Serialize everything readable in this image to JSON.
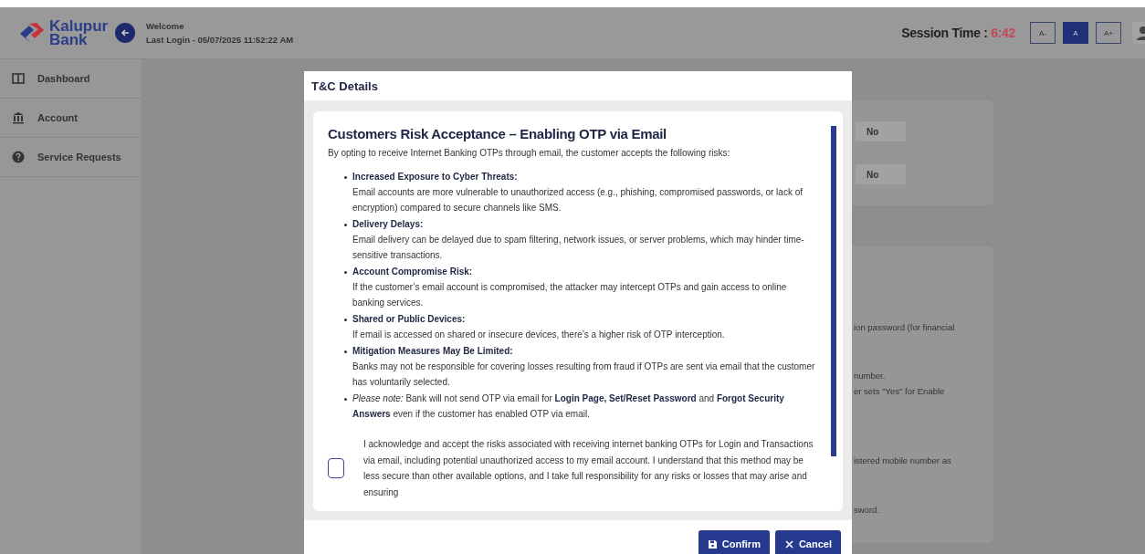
{
  "header": {
    "logo": {
      "line1": "Kalupur",
      "line2": "Bank"
    },
    "welcome": "Welcome",
    "last_login": "Last Login - 05/07/2025 11:52:22 AM",
    "session_label": "Session Time :",
    "session_time": "6:42",
    "font_buttons": [
      {
        "label": "A-",
        "selected": false
      },
      {
        "label": "A",
        "selected": true
      },
      {
        "label": "A+",
        "selected": false
      }
    ]
  },
  "sidebar": {
    "items": [
      {
        "kind": "dashboard",
        "label": "Dashboard"
      },
      {
        "kind": "account",
        "label": "Account"
      },
      {
        "kind": "help",
        "label": "Service Requests"
      }
    ]
  },
  "background": {
    "settings_values": [
      "No",
      "No"
    ],
    "info_lines": [
      "ion password (for financial",
      "number.",
      "er sets \"Yes\" for Enable",
      "istered mobile number as",
      "sword."
    ]
  },
  "modal": {
    "title": "T&C Details",
    "heading": "Customers Risk Acceptance – Enabling OTP via Email",
    "intro": "By opting to receive Internet Banking OTPs through email, the customer accepts the following risks:",
    "items": [
      {
        "kind": "risk",
        "title": "Increased Exposure to Cyber Threats:",
        "body": "Email accounts are more vulnerable to unauthorized access (e.g., phishing, compromised passwords, or lack of encryption) compared to secure channels like SMS."
      },
      {
        "kind": "risk",
        "title": "Delivery Delays:",
        "body": "Email delivery can be delayed due to spam filtering, network issues, or server problems, which may hinder time-sensitive transactions."
      },
      {
        "kind": "risk",
        "title": "Account Compromise Risk:",
        "body": "If the customer’s email account is compromised, the attacker may intercept OTPs and gain access to online banking services."
      },
      {
        "kind": "risk",
        "title": "Shared or Public Devices:",
        "body": "If email is accessed on shared or insecure devices, there’s a higher risk of OTP interception."
      },
      {
        "kind": "risk",
        "title": "Mitigation Measures May Be Limited:",
        "body": "Banks may not be responsible for covering losses resulting from fraud if OTPs are sent via email that the customer has voluntarily selected."
      },
      {
        "kind": "note",
        "text": "*Please note:* Bank will not send OTP via email for **Login Page, Set/Reset Password** and **Forgot Security Answers** even if the customer has enabled OTP via email."
      }
    ],
    "acknowledgement": {
      "checked": false,
      "text": "I acknowledge and accept the risks associated with receiving internet banking OTPs for Login and Transactions via email, including potential unauthorized access to my email account. I understand that this method may be less secure than other available options, and I take full responsibility for any risks or losses that may arise and ensuring"
    },
    "buttons": [
      {
        "kind": "confirm",
        "label": "Confirm"
      },
      {
        "kind": "cancel",
        "label": "Cancel"
      }
    ]
  }
}
